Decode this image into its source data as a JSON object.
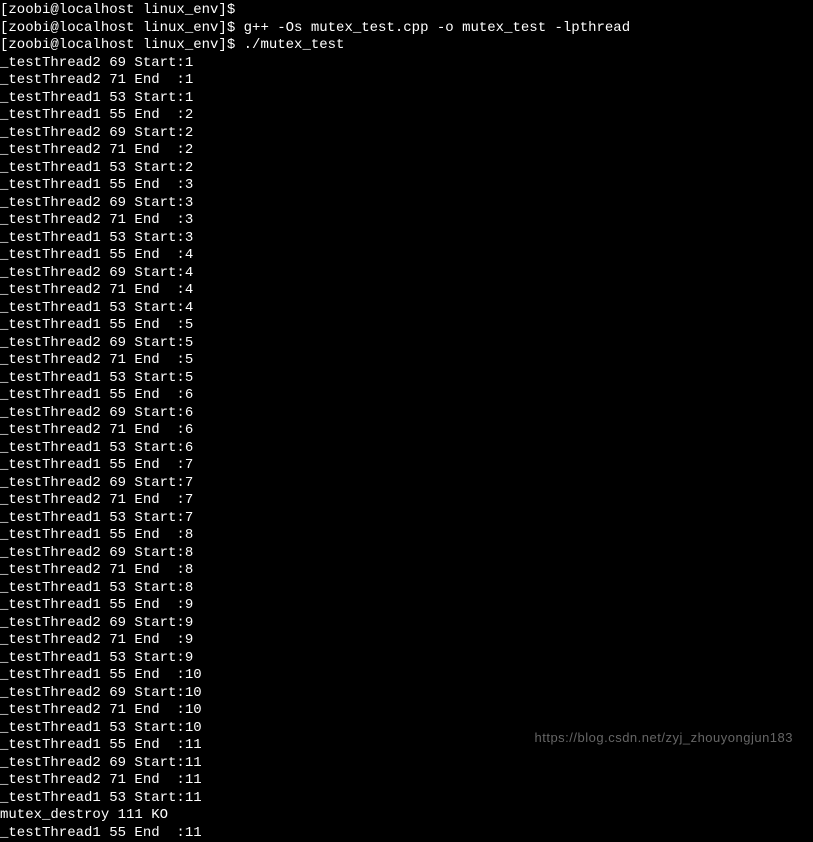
{
  "terminal": {
    "lines": [
      "[zoobi@localhost linux_env]$",
      "[zoobi@localhost linux_env]$ g++ -Os mutex_test.cpp -o mutex_test -lpthread",
      "[zoobi@localhost linux_env]$ ./mutex_test",
      "_testThread2 69 Start:1",
      "_testThread2 71 End  :1",
      "_testThread1 53 Start:1",
      "_testThread1 55 End  :2",
      "_testThread2 69 Start:2",
      "_testThread2 71 End  :2",
      "_testThread1 53 Start:2",
      "_testThread1 55 End  :3",
      "_testThread2 69 Start:3",
      "_testThread2 71 End  :3",
      "_testThread1 53 Start:3",
      "_testThread1 55 End  :4",
      "_testThread2 69 Start:4",
      "_testThread2 71 End  :4",
      "_testThread1 53 Start:4",
      "_testThread1 55 End  :5",
      "_testThread2 69 Start:5",
      "_testThread2 71 End  :5",
      "_testThread1 53 Start:5",
      "_testThread1 55 End  :6",
      "_testThread2 69 Start:6",
      "_testThread2 71 End  :6",
      "_testThread1 53 Start:6",
      "_testThread1 55 End  :7",
      "_testThread2 69 Start:7",
      "_testThread2 71 End  :7",
      "_testThread1 53 Start:7",
      "_testThread1 55 End  :8",
      "_testThread2 69 Start:8",
      "_testThread2 71 End  :8",
      "_testThread1 53 Start:8",
      "_testThread1 55 End  :9",
      "_testThread2 69 Start:9",
      "_testThread2 71 End  :9",
      "_testThread1 53 Start:9",
      "_testThread1 55 End  :10",
      "_testThread2 69 Start:10",
      "_testThread2 71 End  :10",
      "_testThread1 53 Start:10",
      "_testThread1 55 End  :11",
      "_testThread2 69 Start:11",
      "_testThread2 71 End  :11",
      "_testThread1 53 Start:11",
      "mutex_destroy 111 KO",
      "_testThread1 55 End  :11"
    ]
  },
  "watermark": {
    "text": "https://blog.csdn.net/zyj_zhouyongjun183"
  }
}
